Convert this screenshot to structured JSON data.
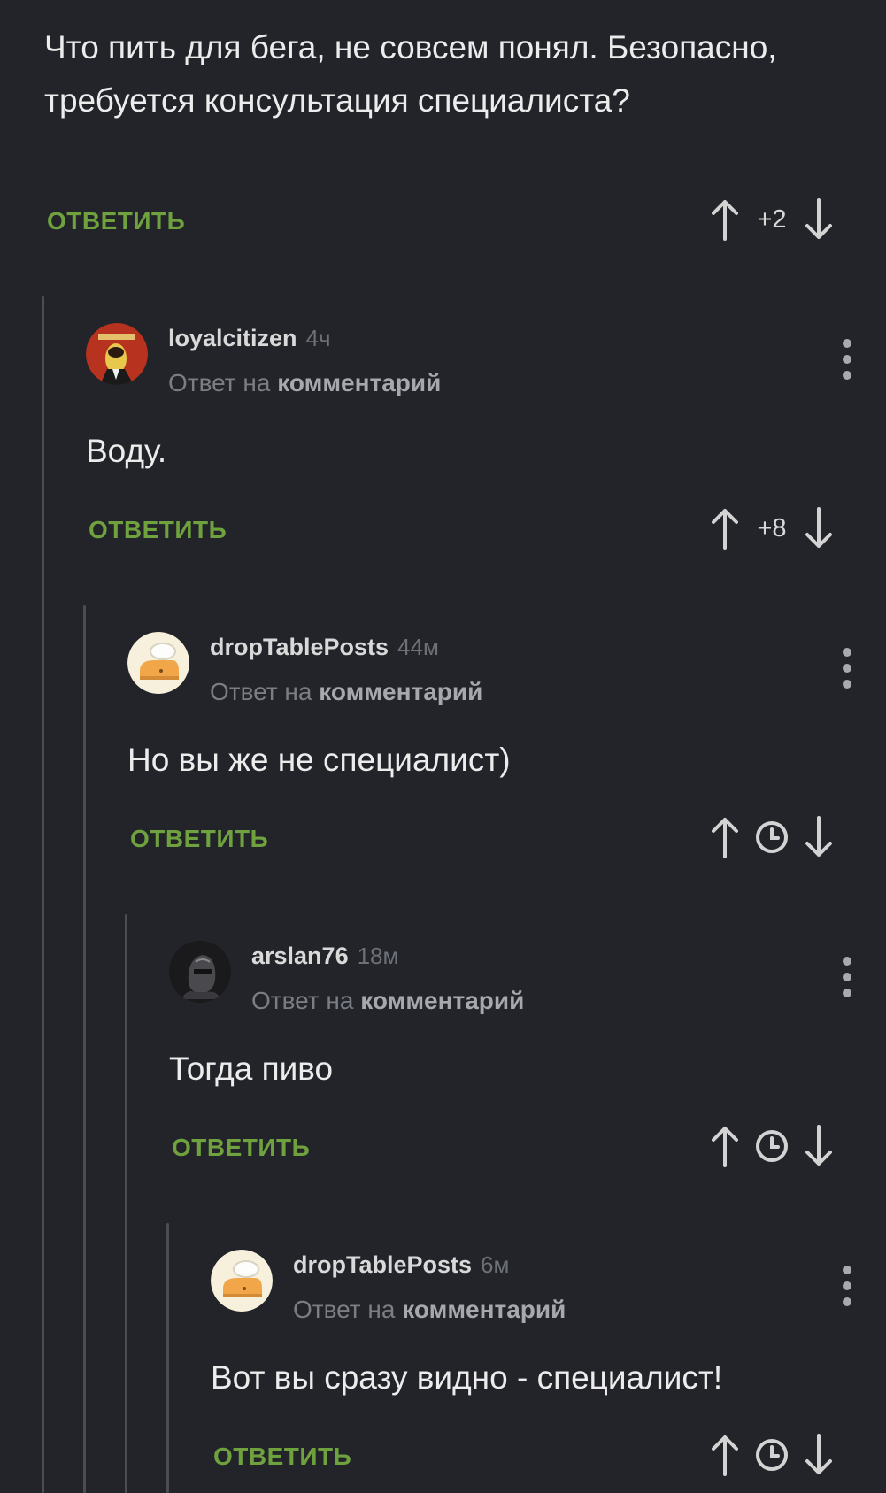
{
  "post": {
    "text": "Что пить для бега, не совсем понял. Безопасно, требуется консультация специалиста?",
    "reply_label": "ОТВЕТИТЬ",
    "score": "+2"
  },
  "comments": [
    {
      "username": "loyalcitizen",
      "time": "4ч",
      "reply_prefix": "Ответ на",
      "reply_target": "комментарий",
      "text": "Воду.",
      "reply_label": "ОТВЕТИТЬ",
      "score": "+8",
      "avatar": "soviet-caricature-avatar"
    },
    {
      "username": "dropTablePosts",
      "time": "44м",
      "reply_prefix": "Ответ на",
      "reply_target": "комментарий",
      "text": "Но вы же не специалист)",
      "reply_label": "ОТВЕТИТЬ",
      "score_icon": "clock-icon",
      "avatar": "chef-hat-avatar"
    },
    {
      "username": "arslan76",
      "time": "18м",
      "reply_prefix": "Ответ на",
      "reply_target": "комментарий",
      "text": "Тогда пиво",
      "reply_label": "ОТВЕТИТЬ",
      "score_icon": "clock-icon",
      "avatar": "knight-helmet-avatar"
    },
    {
      "username": "dropTablePosts",
      "time": "6м",
      "reply_prefix": "Ответ на",
      "reply_target": "комментарий",
      "text": "Вот вы сразу видно - специалист!",
      "reply_label": "ОТВЕТИТЬ",
      "score_icon": "clock-icon",
      "avatar": "chef-hat-avatar"
    }
  ],
  "colors": {
    "background": "#222429",
    "reply_link": "#6fa13e",
    "text": "#ececec",
    "muted": "#7a7d84",
    "thread_line": "#4a4d54"
  }
}
